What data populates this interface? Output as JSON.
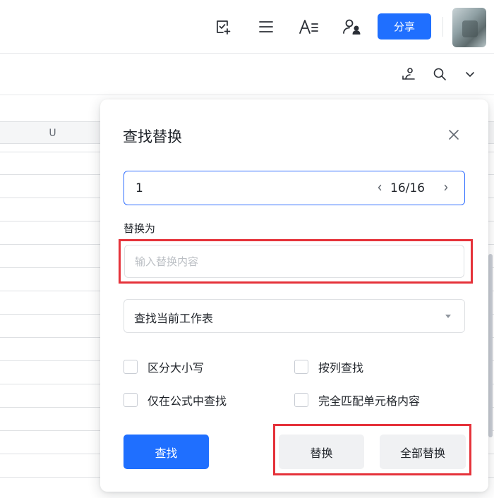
{
  "toolbar": {
    "icons": [
      "doc-check-add-icon",
      "menu-lines-icon",
      "text-format-icon",
      "collaborators-icon"
    ],
    "share_label": "分享",
    "avatar": "user-avatar"
  },
  "subbar": {
    "icons": [
      "user-pin-icon",
      "search-icon",
      "chevron-down-icon"
    ]
  },
  "grid": {
    "column_header": "U"
  },
  "dialog": {
    "title": "查找替换",
    "find_value": "1",
    "match_count": "16/16",
    "replace_label": "替换为",
    "replace_placeholder": "输入替换内容",
    "scope_value": "查找当前工作表",
    "options": {
      "case_sensitive": "区分大小写",
      "by_column": "按列查找",
      "formula_only": "仅在公式中查找",
      "whole_cell": "完全匹配单元格内容"
    },
    "find_button": "查找",
    "replace_button": "替换",
    "replace_all_button": "全部替换"
  },
  "colors": {
    "accent": "#1f6fff",
    "highlight_red": "#e5323a",
    "button_gray": "#f0f1f3"
  }
}
